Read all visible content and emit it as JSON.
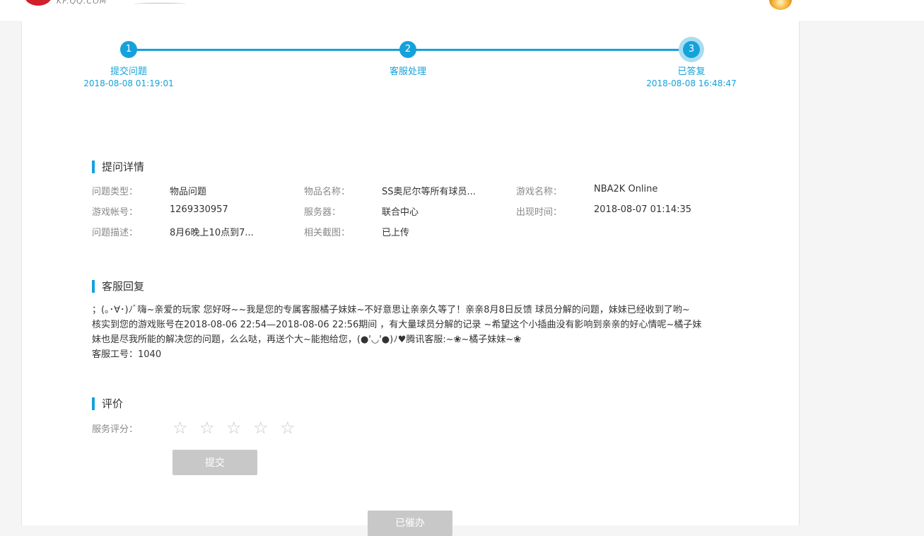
{
  "header": {
    "logo_text": "KF.QQ.COM"
  },
  "progress": {
    "steps": [
      {
        "num": "1",
        "label": "提交问题",
        "time": "2018-08-08 01:19:01"
      },
      {
        "num": "2",
        "label": "客服处理",
        "time": ""
      },
      {
        "num": "3",
        "label": "已答复",
        "time": "2018-08-08 16:48:47"
      }
    ],
    "active_step": 3,
    "accent_color": "#15a2db"
  },
  "details": {
    "title": "提问详情",
    "fields": [
      {
        "label": "问题类型：",
        "value": "物品问题"
      },
      {
        "label": "物品名称：",
        "value": "SS奥尼尔等所有球员..."
      },
      {
        "label": "游戏名称：",
        "value": "NBA2K Online"
      },
      {
        "label": "游戏帐号：",
        "value": "1269330957"
      },
      {
        "label": "服务器：",
        "value": "联合中心"
      },
      {
        "label": "出现时间：",
        "value": "2018-08-07 01:14:35"
      },
      {
        "label": "问题描述：",
        "value": "8月6晚上10点到7..."
      },
      {
        "label": "相关截图：",
        "value": "已上传"
      }
    ]
  },
  "reply": {
    "title": "客服回复",
    "lines": [
      "；(｡･∀･)ﾉﾞ嗨~亲爱的玩家 您好呀~~我是您的专属客服橘子妹妹~不好意思让亲亲久等了！亲亲8月8日反馈 球员分解的问题，妹妹已经收到了哟~",
      "核实到您的游戏账号在2018-08-06 22:54—2018-08-06 22:56期间 ，有大量球员分解的记录 ~希望这个小插曲没有影响到亲亲的好心情呢~橘子妹",
      "妹也是尽我所能的解决您的问题，么么哒，再送个大~能抱给您，(●'◡'●)ﾉ♥腾讯客服:~❀~橘子妹妹~❀",
      "客服工号：1040"
    ]
  },
  "rating": {
    "title": "评价",
    "label": "服务评分：",
    "stars": [
      "☆",
      "☆",
      "☆",
      "☆",
      "☆"
    ],
    "rating_value": 0,
    "max_rating": 5,
    "submit_label": "提交"
  },
  "footer": {
    "urge_label": "已催办"
  }
}
